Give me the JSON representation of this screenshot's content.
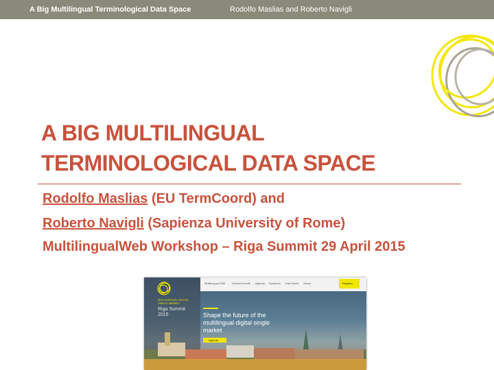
{
  "header": {
    "title": "A Big Multilingual Terminological Data Space",
    "authors": "Rodolfo Maslias and Roberto Navigli"
  },
  "slide": {
    "title_line1": "A BIG MULTILINGUAL",
    "title_line2": "TERMINOLOGICAL DATA SPACE",
    "author1_name": "Rodolfo Maslias",
    "author1_affil": " (EU TermCoord) and",
    "author2_name": "Roberto Navigli",
    "author2_affil": " (Sapienza University of Rome)",
    "event": "MultilingualWeb Workshop – Riga Summit 29 April 2015"
  },
  "website": {
    "nav": [
      "Multilingual DSM",
      "Summit Events",
      "Agenda",
      "Speakers",
      "Fact Sheet",
      "Venue"
    ],
    "register": "Register",
    "org_name": "MULTILINGUAL DIGITAL SINGLE MARKET",
    "summit": "Riga Summit 2015",
    "tagline": "Shape the future of the multilingual digital single market",
    "agenda_button": "Agenda"
  },
  "colors": {
    "accent": "#c8523c",
    "topbar": "#8a8a7a",
    "yellow": "#f0e600"
  }
}
